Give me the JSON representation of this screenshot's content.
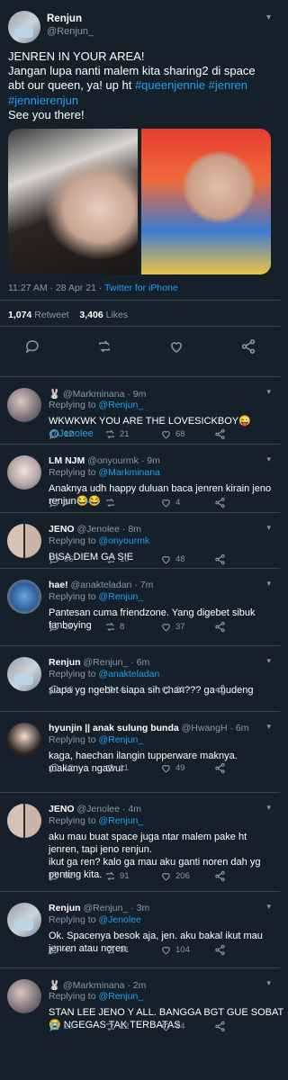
{
  "main_tweet": {
    "name": "Renjun",
    "handle": "@Renjun_",
    "text_lines": [
      [
        {
          "t": "JENREN IN YOUR AREA!"
        }
      ],
      [
        {
          "t": "Jangan lupa nanti malem kita sharing2 di space"
        }
      ],
      [
        {
          "t": "abt our queen, ya! up ht "
        },
        {
          "t": "#queenjennie",
          "link": true
        },
        {
          "t": " "
        },
        {
          "t": "#jenren",
          "link": true
        }
      ],
      [
        {
          "t": "#jennierenjun",
          "link": true
        }
      ],
      [
        {
          "t": "See you there!"
        }
      ]
    ],
    "time": "11:27 AM",
    "date": "28 Apr 21",
    "source": "Twitter for iPhone",
    "retweets_count": "1,074",
    "retweets_label": "Retweet",
    "likes_count": "3,406",
    "likes_label": "Likes"
  },
  "replies": [
    {
      "name": "🐰",
      "handle": "@Markminana",
      "time": "9m",
      "replying_to": "@Renjun_",
      "body_lines": [
        [
          {
            "t": "WKWKWK YOU ARE THE LOVESICKBOY😜"
          }
        ],
        [
          {
            "t": "@Jenolee",
            "link": true
          }
        ]
      ],
      "replies": "12",
      "retweets": "21",
      "likes": "68"
    },
    {
      "name": "LM NJM",
      "handle": "@onyourmk",
      "time": "9m",
      "replying_to": "@Markminana",
      "body_lines": [
        [
          {
            "t": "Anaknya udh happy duluan baca jenren kirain jeno"
          }
        ],
        [
          {
            "t": "renjun😂😂"
          }
        ]
      ],
      "replies": "3",
      "retweets": "",
      "likes": "4"
    },
    {
      "name": "JENO",
      "handle": "@Jenolee",
      "time": "8m",
      "replying_to": "@onyourmk",
      "body_lines": [
        [
          {
            "t": "BISA DIEM GA SIE"
          }
        ]
      ],
      "replies": "36",
      "retweets": "10",
      "likes": "48"
    },
    {
      "name": "hae!",
      "handle": "@anakteladan",
      "time": "7m",
      "replying_to": "@Renjun_",
      "body_lines": [
        [
          {
            "t": "Pantesan cuma friendzone. Yang digebet sibuk"
          }
        ],
        [
          {
            "t": "fanboying"
          }
        ]
      ],
      "replies": "11",
      "retweets": "8",
      "likes": "37"
    },
    {
      "name": "Renjun",
      "handle": "@Renjun_",
      "time": "6m",
      "replying_to": "@anakteladan",
      "body_lines": [
        [
          {
            "t": "siapa yg ngebet siapa sih chan??? ga mudeng"
          }
        ]
      ],
      "replies": "18",
      "retweets": "4",
      "likes": "22"
    },
    {
      "name": "hyunjin || anak sulung bunda",
      "handle": "@HwangH",
      "time": "6m",
      "replying_to": "@Renjun_",
      "body_lines": [
        [
          {
            "t": "kaga, haechan ilangin tupperware maknya."
          }
        ],
        [
          {
            "t": "makanya ngawur"
          }
        ]
      ],
      "replies": "12",
      "retweets": "11",
      "likes": "49"
    },
    {
      "name": "JENO",
      "handle": "@Jenolee",
      "time": "4m",
      "replying_to": "@Renjun_",
      "body_lines": [
        [
          {
            "t": "aku mau buat space juga ntar malem pake ht"
          }
        ],
        [
          {
            "t": "jenren, tapi jeno renjun."
          }
        ],
        [
          {
            "t": "ikut ga ren? kalo ga mau aku ganti noren dah yg"
          }
        ],
        [
          {
            "t": "penting kita."
          }
        ]
      ],
      "replies": "92",
      "retweets": "91",
      "likes": "206"
    },
    {
      "name": "Renjun",
      "handle": "@Renjun_",
      "time": "3m",
      "replying_to": "@Jenolee",
      "body_lines": [
        [
          {
            "t": "Ok. Spacenya besok aja, jen. aku bakal ikut mau"
          }
        ],
        [
          {
            "t": "jenren atau noren"
          }
        ]
      ],
      "replies": "47",
      "retweets": "31",
      "likes": "104"
    },
    {
      "name": "🐰",
      "handle": "@Markminana",
      "time": "2m",
      "replying_to": "@Renjun_",
      "body_lines": [
        [
          {
            "t": "STAN LEE JENO Y ALL. BANGGA BGT GUE SOBAT"
          }
        ],
        [
          {
            "t": "😭 NGEGAS TAK TERBATAS"
          }
        ]
      ],
      "replies": "29",
      "retweets": "12",
      "likes": "84"
    }
  ],
  "labels": {
    "replying_prefix": "Replying to ",
    "dot": " · "
  }
}
